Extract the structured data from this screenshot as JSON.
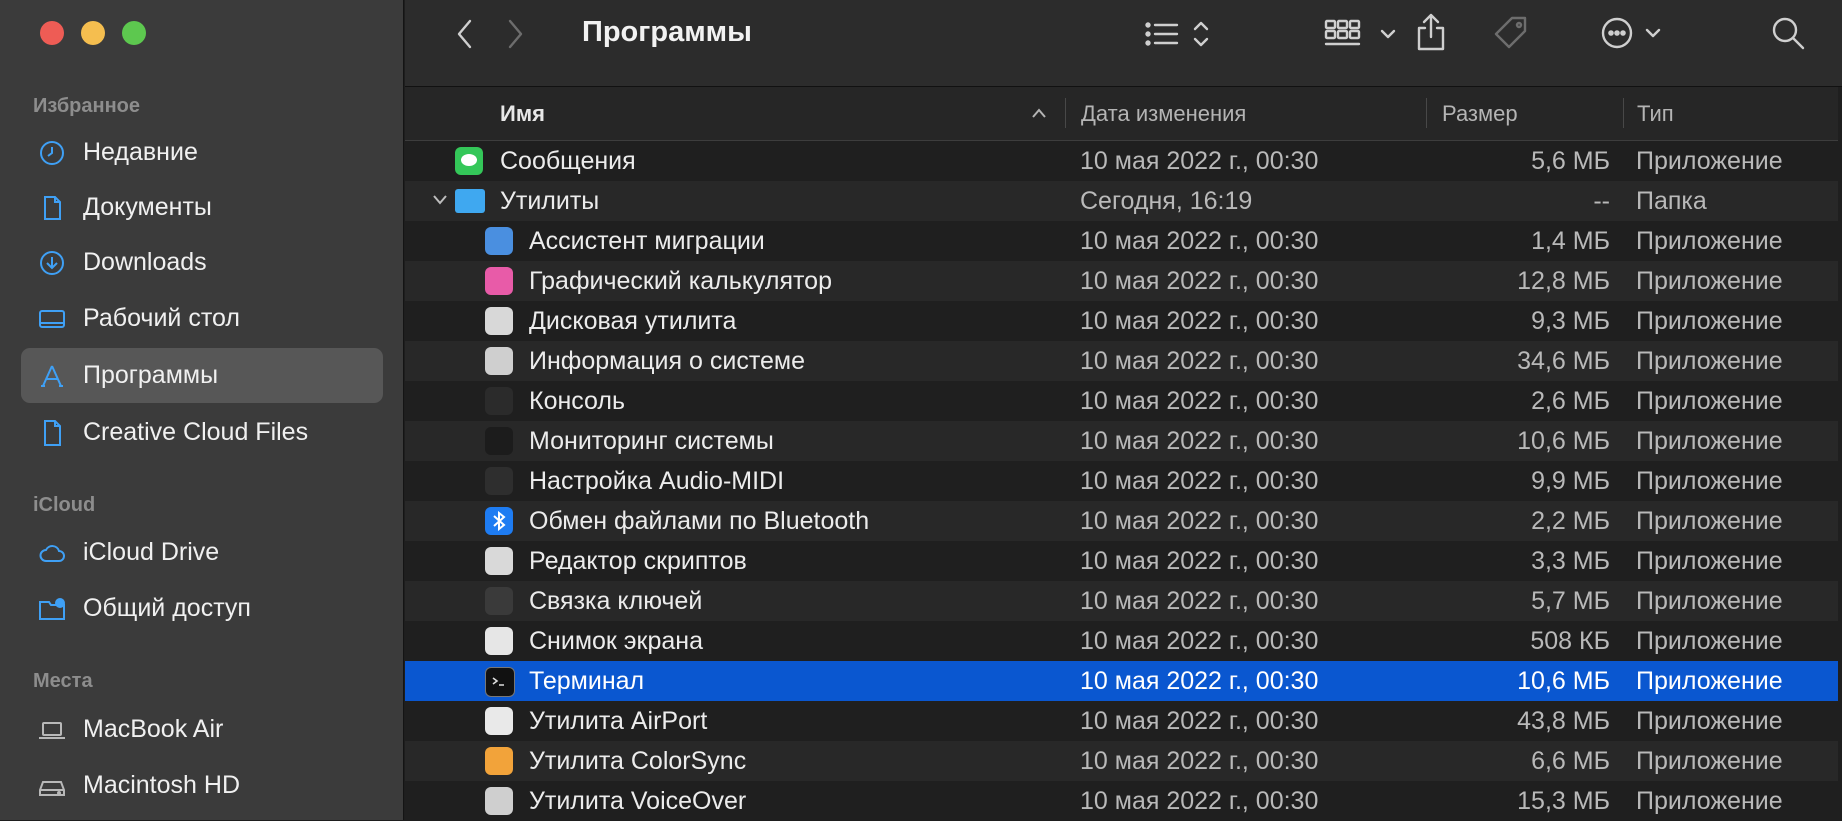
{
  "window": {
    "title": "Программы"
  },
  "sidebar": {
    "sections": [
      {
        "label": "Избранное"
      },
      {
        "label": "iCloud"
      },
      {
        "label": "Места"
      }
    ],
    "items": [
      {
        "label": "Недавние",
        "icon": "clock-icon"
      },
      {
        "label": "Документы",
        "icon": "document-icon"
      },
      {
        "label": "Downloads",
        "icon": "download-icon"
      },
      {
        "label": "Рабочий стол",
        "icon": "desktop-icon"
      },
      {
        "label": "Программы",
        "icon": "applications-icon",
        "active": true
      },
      {
        "label": "Creative Cloud Files",
        "icon": "file-icon"
      },
      {
        "label": "iCloud Drive",
        "icon": "cloud-icon"
      },
      {
        "label": "Общий доступ",
        "icon": "shared-folder-icon"
      },
      {
        "label": "MacBook Air",
        "icon": "laptop-icon"
      },
      {
        "label": "Macintosh HD",
        "icon": "hard-drive-icon"
      }
    ]
  },
  "columns": {
    "name": "Имя",
    "date": "Дата изменения",
    "size": "Размер",
    "type": "Тип"
  },
  "files": [
    {
      "name": "Сообщения",
      "date": "10 мая 2022 г., 00:30",
      "size": "5,6 МБ",
      "type": "Приложение",
      "icon": "messages-icon",
      "color": "#34c759"
    },
    {
      "name": "Утилиты",
      "date": "Сегодня, 16:19",
      "size": "--",
      "type": "Папка",
      "icon": "folder-icon",
      "color": "#3fa8f0"
    },
    {
      "name": "Ассистент миграции",
      "date": "10 мая 2022 г., 00:30",
      "size": "1,4 МБ",
      "type": "Приложение",
      "icon": "migration-assistant-icon",
      "color": "#4a8fe0"
    },
    {
      "name": "Графический калькулятор",
      "date": "10 мая 2022 г., 00:30",
      "size": "12,8 МБ",
      "type": "Приложение",
      "icon": "grapher-icon",
      "color": "#e85ba8"
    },
    {
      "name": "Дисковая утилита",
      "date": "10 мая 2022 г., 00:30",
      "size": "9,3 МБ",
      "type": "Приложение",
      "icon": "disk-utility-icon",
      "color": "#d8d8d8"
    },
    {
      "name": "Информация о системе",
      "date": "10 мая 2022 г., 00:30",
      "size": "34,6 МБ",
      "type": "Приложение",
      "icon": "system-info-icon",
      "color": "#cfcfcf"
    },
    {
      "name": "Консоль",
      "date": "10 мая 2022 г., 00:30",
      "size": "2,6 МБ",
      "type": "Приложение",
      "icon": "console-icon",
      "color": "#2b2b2b"
    },
    {
      "name": "Мониторинг системы",
      "date": "10 мая 2022 г., 00:30",
      "size": "10,6 МБ",
      "type": "Приложение",
      "icon": "activity-monitor-icon",
      "color": "#1c1c1c"
    },
    {
      "name": "Настройка Audio-MIDI",
      "date": "10 мая 2022 г., 00:30",
      "size": "9,9 МБ",
      "type": "Приложение",
      "icon": "audio-midi-icon",
      "color": "#2e2e2e"
    },
    {
      "name": "Обмен файлами по Bluetooth",
      "date": "10 мая 2022 г., 00:30",
      "size": "2,2 МБ",
      "type": "Приложение",
      "icon": "bluetooth-icon",
      "color": "#1e7cf2"
    },
    {
      "name": "Редактор скриптов",
      "date": "10 мая 2022 г., 00:30",
      "size": "3,3 МБ",
      "type": "Приложение",
      "icon": "script-editor-icon",
      "color": "#d9d9d9"
    },
    {
      "name": "Связка ключей",
      "date": "10 мая 2022 г., 00:30",
      "size": "5,7 МБ",
      "type": "Приложение",
      "icon": "keychain-icon",
      "color": "#3a3a3a"
    },
    {
      "name": "Снимок экрана",
      "date": "10 мая 2022 г., 00:30",
      "size": "508 КБ",
      "type": "Приложение",
      "icon": "screenshot-icon",
      "color": "#e6e6e6"
    },
    {
      "name": "Терминал",
      "date": "10 мая 2022 г., 00:30",
      "size": "10,6 МБ",
      "type": "Приложение",
      "icon": "terminal-icon",
      "color": "#111111",
      "selected": true
    },
    {
      "name": "Утилита AirPort",
      "date": "10 мая 2022 г., 00:30",
      "size": "43,8 МБ",
      "type": "Приложение",
      "icon": "airport-icon",
      "color": "#e9e9e9"
    },
    {
      "name": "Утилита ColorSync",
      "date": "10 мая 2022 г., 00:30",
      "size": "6,6 МБ",
      "type": "Приложение",
      "icon": "colorsync-icon",
      "color": "#f2a33a"
    },
    {
      "name": "Утилита VoiceOver",
      "date": "10 мая 2022 г., 00:30",
      "size": "15,3 МБ",
      "type": "Приложение",
      "icon": "voiceover-icon",
      "color": "#cfcfcf"
    }
  ]
}
